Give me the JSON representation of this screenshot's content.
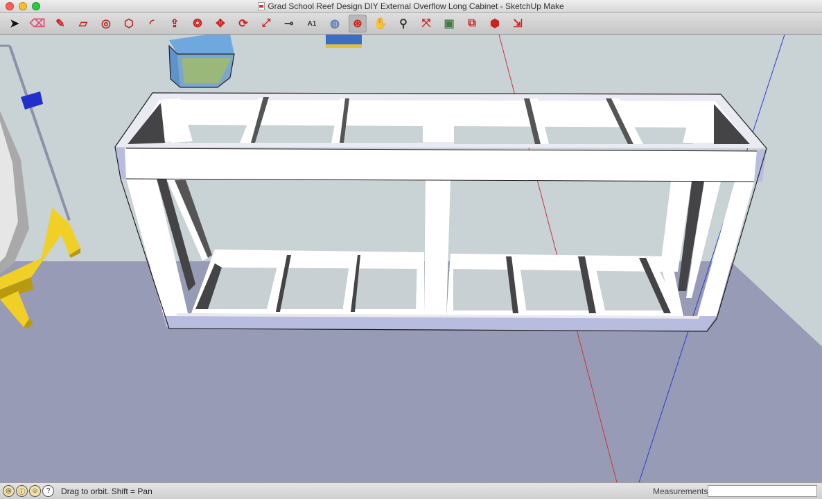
{
  "window": {
    "title": "Grad School Reef Design DIY External Overflow Long Cabinet - SketchUp Make"
  },
  "toolbar": {
    "tools": [
      {
        "name": "select-tool",
        "glyph": "➤",
        "color": "#111111"
      },
      {
        "name": "eraser-tool",
        "glyph": "⌫",
        "color": "#e0507a"
      },
      {
        "name": "pencil-tool",
        "glyph": "✎",
        "color": "#cc2222"
      },
      {
        "name": "rectangle-tool",
        "glyph": "▱",
        "color": "#bb2222"
      },
      {
        "name": "circle-tool",
        "glyph": "◎",
        "color": "#bb2222"
      },
      {
        "name": "polygon-tool",
        "glyph": "⬡",
        "color": "#bb2222"
      },
      {
        "name": "arc-tool",
        "glyph": "◜",
        "color": "#bb2222"
      },
      {
        "name": "push-pull-tool",
        "glyph": "⇪",
        "color": "#bb2222"
      },
      {
        "name": "follow-me-tool",
        "glyph": "❂",
        "color": "#cc2222"
      },
      {
        "name": "move-tool",
        "glyph": "✥",
        "color": "#cc2222"
      },
      {
        "name": "rotate-tool",
        "glyph": "⟳",
        "color": "#cc2222"
      },
      {
        "name": "scale-tool",
        "glyph": "⤢",
        "color": "#cc2222"
      },
      {
        "name": "tape-measure-tool",
        "glyph": "⊸",
        "color": "#444444"
      },
      {
        "name": "text-tool",
        "glyph": "A1",
        "color": "#333333"
      },
      {
        "name": "paint-bucket-tool",
        "glyph": "◍",
        "color": "#5a7fb5"
      },
      {
        "name": "orbit-tool",
        "glyph": "⊛",
        "color": "#cc2222"
      },
      {
        "name": "pan-tool",
        "glyph": "✋",
        "color": "#555555"
      },
      {
        "name": "zoom-tool",
        "glyph": "⚲",
        "color": "#333333"
      },
      {
        "name": "zoom-extents-tool",
        "glyph": "⤧",
        "color": "#cc2222"
      },
      {
        "name": "previous-view-tool",
        "glyph": "▣",
        "color": "#447744"
      },
      {
        "name": "get-models-tool",
        "glyph": "⧉",
        "color": "#cc2222"
      },
      {
        "name": "share-model-tool",
        "glyph": "⬢",
        "color": "#cc2222"
      },
      {
        "name": "extension-warehouse-tool",
        "glyph": "⇲",
        "color": "#cc2222"
      }
    ],
    "active_tool": "orbit-tool"
  },
  "status": {
    "hint": "Drag to orbit.  Shift = Pan",
    "icons": [
      "geo-location-icon",
      "credits-icon",
      "user-icon",
      "help-icon"
    ],
    "measurements_label": "Measurements",
    "measurements_value": ""
  },
  "colors": {
    "sky": "#c9d2d5",
    "ground": "#989bb5",
    "wood_front": "#ffffff",
    "wood_shadow": "#3c3c3e",
    "selected_face": "#b8bde0",
    "tank_glass": "#5f92c8",
    "stand_yellow": "#f0cf27",
    "axis_red": "#cc3333",
    "axis_blue": "#2a3ad4"
  }
}
